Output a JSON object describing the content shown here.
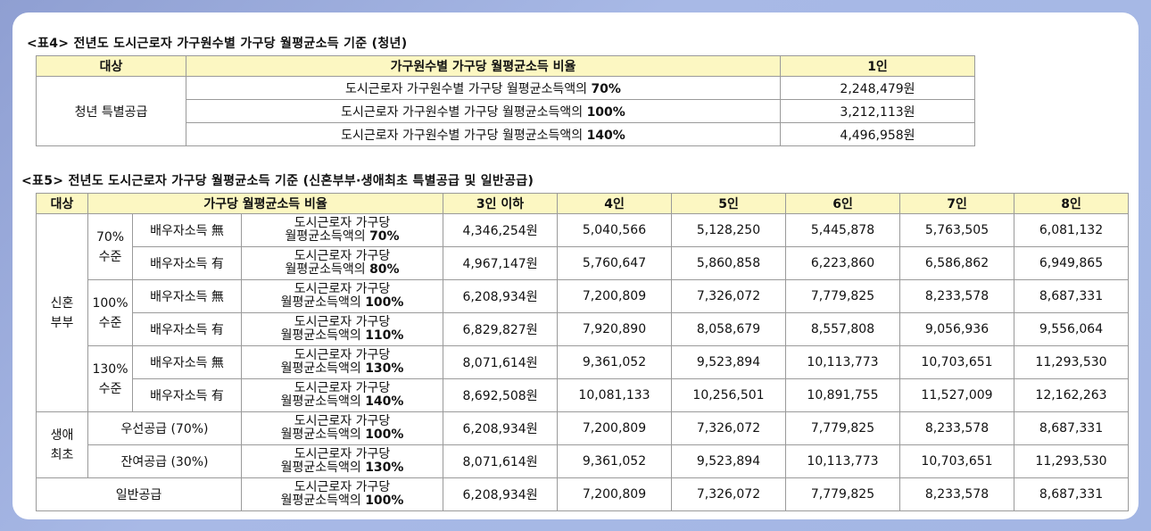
{
  "table4": {
    "caption": "<표4> 전년도 도시근로자 가구원수별 가구당 월평균소득 기준 (청년)",
    "headers": [
      "대상",
      "가구원수별 가구당 월평균소득 비율",
      "1인"
    ],
    "target": "청년 특별공급",
    "rows": [
      {
        "desc": "도시근로자 가구원수별 가구당 월평균소득액의",
        "pct": "70%",
        "value": "2,248,479원"
      },
      {
        "desc": "도시근로자 가구원수별 가구당 월평균소득액의",
        "pct": "100%",
        "value": "3,212,113원"
      },
      {
        "desc": "도시근로자 가구원수별 가구당 월평균소득액의",
        "pct": "140%",
        "value": "4,496,958원"
      }
    ]
  },
  "table5": {
    "caption": "<표5> 전년도 도시근로자 가구당 월평균소득 기준 (신혼부부·생애최초 특별공급 및 일반공급)",
    "headers": [
      "대상",
      "가구당 월평균소득 비율",
      "3인 이하",
      "4인",
      "5인",
      "6인",
      "7인",
      "8인"
    ],
    "desc_line1": "도시근로자 가구당",
    "desc_line2": "월평균소득액의",
    "groups": {
      "newlywed": "신혼\n부부",
      "first_time": "생애\n최초",
      "general": "일반공급"
    },
    "levels": [
      "70%\n수준",
      "100%\n수준",
      "130%\n수준"
    ],
    "rows": [
      {
        "sub": "배우자소득 無",
        "pct": "70%",
        "values": [
          "4,346,254원",
          "5,040,566",
          "5,128,250",
          "5,445,878",
          "5,763,505",
          "6,081,132"
        ]
      },
      {
        "sub": "배우자소득 有",
        "pct": "80%",
        "values": [
          "4,967,147원",
          "5,760,647",
          "5,860,858",
          "6,223,860",
          "6,586,862",
          "6,949,865"
        ]
      },
      {
        "sub": "배우자소득 無",
        "pct": "100%",
        "values": [
          "6,208,934원",
          "7,200,809",
          "7,326,072",
          "7,779,825",
          "8,233,578",
          "8,687,331"
        ]
      },
      {
        "sub": "배우자소득 有",
        "pct": "110%",
        "values": [
          "6,829,827원",
          "7,920,890",
          "8,058,679",
          "8,557,808",
          "9,056,936",
          "9,556,064"
        ]
      },
      {
        "sub": "배우자소득 無",
        "pct": "130%",
        "values": [
          "8,071,614원",
          "9,361,052",
          "9,523,894",
          "10,113,773",
          "10,703,651",
          "11,293,530"
        ]
      },
      {
        "sub": "배우자소득 有",
        "pct": "140%",
        "values": [
          "8,692,508원",
          "10,081,133",
          "10,256,501",
          "10,891,755",
          "11,527,009",
          "12,162,263"
        ]
      },
      {
        "sub": "우선공급 (70%)",
        "pct": "100%",
        "values": [
          "6,208,934원",
          "7,200,809",
          "7,326,072",
          "7,779,825",
          "8,233,578",
          "8,687,331"
        ]
      },
      {
        "sub": "잔여공급 (30%)",
        "pct": "130%",
        "values": [
          "8,071,614원",
          "9,361,052",
          "9,523,894",
          "10,113,773",
          "10,703,651",
          "11,293,530"
        ]
      },
      {
        "sub": "",
        "pct": "100%",
        "values": [
          "6,208,934원",
          "7,200,809",
          "7,326,072",
          "7,779,825",
          "8,233,578",
          "8,687,331"
        ]
      }
    ]
  }
}
